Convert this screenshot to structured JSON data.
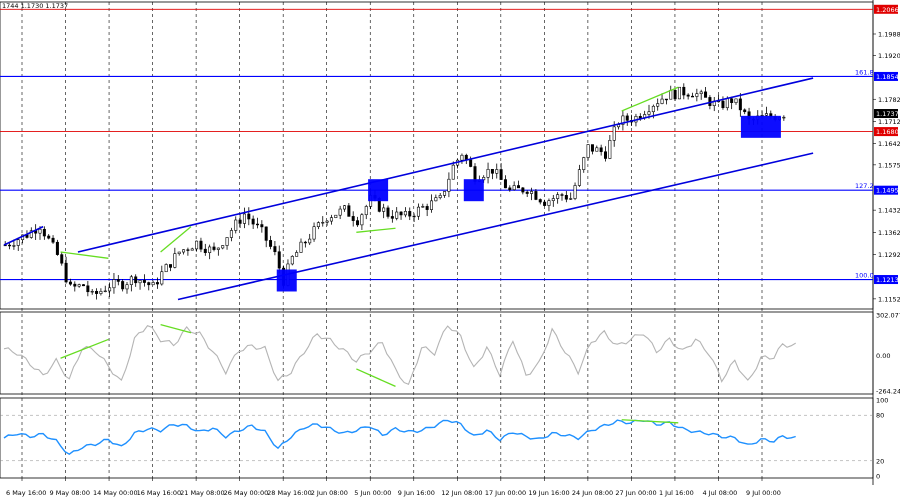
{
  "header_text": "1744 1.1730 1.1737",
  "colors": {
    "candle": "#000000",
    "channel": "#0000dd",
    "fib_line": "#0000ff",
    "red_line": "#e00000",
    "marker": "#0000ff",
    "divergence": "#66dd22",
    "cci": "#b4b4b4",
    "rsi": "#1e90ff",
    "grid": "#000000"
  },
  "chart_data": [
    {
      "type": "candlestick",
      "ylim": [
        1.112,
        1.2089
      ],
      "price_ticks": [
        "1.1988",
        "1.1920",
        "1.1782",
        "1.1712",
        "1.1642",
        "1.1575",
        "1.1432",
        "1.1362",
        "1.1292",
        "1.1152"
      ],
      "x_tick_labels": [
        "6 May 16:00",
        "9 May 08:00",
        "14 May 00:00",
        "16 May 16:00",
        "21 May 08:00",
        "26 May 00:00",
        "28 May 16:00",
        "2 Jun 08:00",
        "5 Jun 00:00",
        "9 Jun 16:00",
        "12 Jun 08:00",
        "17 Jun 00:00",
        "19 Jun 16:00",
        "24 Jun 08:00",
        "27 Jun 00:00",
        "1 Jul 16:00",
        "4 Jul 08:00",
        "9 Jul 00:00"
      ],
      "bar_count": 180,
      "close_path": [
        [
          0,
          1.1322
        ],
        [
          5,
          1.1355
        ],
        [
          8,
          1.1385
        ],
        [
          12,
          1.129
        ],
        [
          15,
          1.1185
        ],
        [
          18,
          1.1195
        ],
        [
          20,
          1.116
        ],
        [
          24,
          1.1195
        ],
        [
          27,
          1.12
        ],
        [
          30,
          1.122
        ],
        [
          34,
          1.119
        ],
        [
          36,
          1.1232
        ],
        [
          40,
          1.13
        ],
        [
          44,
          1.133
        ],
        [
          48,
          1.13
        ],
        [
          52,
          1.137
        ],
        [
          55,
          1.142
        ],
        [
          59,
          1.1362
        ],
        [
          62,
          1.1292
        ],
        [
          64,
          1.121
        ],
        [
          66,
          1.128
        ],
        [
          70,
          1.135
        ],
        [
          74,
          1.1412
        ],
        [
          78,
          1.1432
        ],
        [
          81,
          1.1402
        ],
        [
          84,
          1.1465
        ],
        [
          88,
          1.142
        ],
        [
          92,
          1.1412
        ],
        [
          96,
          1.144
        ],
        [
          100,
          1.1465
        ],
        [
          103,
          1.157
        ],
        [
          105,
          1.1612
        ],
        [
          108,
          1.154
        ],
        [
          112,
          1.156
        ],
        [
          116,
          1.1492
        ],
        [
          120,
          1.15
        ],
        [
          124,
          1.146
        ],
        [
          128,
          1.148
        ],
        [
          130,
          1.147
        ],
        [
          134,
          1.163
        ],
        [
          138,
          1.1612
        ],
        [
          141,
          1.1712
        ],
        [
          145,
          1.1725
        ],
        [
          148,
          1.176
        ],
        [
          152,
          1.1795
        ],
        [
          156,
          1.1805
        ],
        [
          158,
          1.1805
        ],
        [
          161,
          1.1782
        ],
        [
          164,
          1.176
        ],
        [
          167,
          1.178
        ],
        [
          169,
          1.1755
        ],
        [
          171,
          1.1712
        ],
        [
          174,
          1.1725
        ],
        [
          177,
          1.173
        ],
        [
          179,
          1.1737
        ]
      ],
      "horizontal_levels": [
        {
          "label": "1.2066",
          "value": 1.2066,
          "kind": "red"
        },
        {
          "label": "1.1854",
          "value": 1.1854,
          "kind": "blue",
          "fib_label": "161.8"
        },
        {
          "label": "1.1680",
          "value": 1.168,
          "kind": "red"
        },
        {
          "label": "1.1495",
          "value": 1.1495,
          "kind": "blue",
          "fib_label": "127.2"
        },
        {
          "label": "1.1213",
          "value": 1.1213,
          "kind": "blue",
          "fib_label": "100.0"
        }
      ],
      "current_price": "1.1737",
      "channel_lines": [
        {
          "from": [
            17,
            1.13
          ],
          "to": [
            186,
            1.1849
          ]
        },
        {
          "from": [
            40,
            1.115
          ],
          "to": [
            186,
            1.1612
          ]
        },
        {
          "from": [
            0,
            1.1322
          ],
          "to": [
            9,
            1.138
          ]
        }
      ],
      "markers": [
        {
          "bar": 65,
          "value": 1.121
        },
        {
          "bar": 86,
          "value": 1.1495
        },
        {
          "bar": 108,
          "value": 1.1495
        },
        {
          "bar": 174,
          "value": 1.1695
        }
      ],
      "divergence_lines": [
        {
          "from": [
            13,
            1.13
          ],
          "to": [
            24,
            1.128
          ]
        },
        {
          "from": [
            36,
            1.13
          ],
          "to": [
            43,
            1.138
          ]
        },
        {
          "from": [
            81,
            1.1362
          ],
          "to": [
            90,
            1.1375
          ]
        },
        {
          "from": [
            142,
            1.1745
          ],
          "to": [
            155,
            1.182
          ]
        }
      ]
    },
    {
      "type": "line",
      "name": "",
      "ylim": [
        -264.246,
        302.077
      ],
      "ticks": [
        "302.077",
        "0.00",
        "-264.246"
      ],
      "values_by_bar": [
        [
          0,
          50
        ],
        [
          3,
          20
        ],
        [
          6,
          -60
        ],
        [
          9,
          -150
        ],
        [
          12,
          -40
        ],
        [
          15,
          -180
        ],
        [
          18,
          60
        ],
        [
          21,
          40
        ],
        [
          24,
          -80
        ],
        [
          27,
          -200
        ],
        [
          30,
          120
        ],
        [
          33,
          230
        ],
        [
          36,
          120
        ],
        [
          39,
          80
        ],
        [
          42,
          200
        ],
        [
          45,
          160
        ],
        [
          48,
          30
        ],
        [
          51,
          -120
        ],
        [
          54,
          40
        ],
        [
          57,
          70
        ],
        [
          60,
          50
        ],
        [
          63,
          -190
        ],
        [
          66,
          -120
        ],
        [
          69,
          30
        ],
        [
          72,
          160
        ],
        [
          75,
          110
        ],
        [
          78,
          40
        ],
        [
          81,
          -40
        ],
        [
          84,
          30
        ],
        [
          87,
          100
        ],
        [
          90,
          -110
        ],
        [
          93,
          -230
        ],
        [
          96,
          60
        ],
        [
          99,
          20
        ],
        [
          102,
          230
        ],
        [
          105,
          140
        ],
        [
          108,
          -100
        ],
        [
          111,
          60
        ],
        [
          114,
          -140
        ],
        [
          117,
          120
        ],
        [
          120,
          -150
        ],
        [
          123,
          -60
        ],
        [
          126,
          190
        ],
        [
          129,
          30
        ],
        [
          132,
          -120
        ],
        [
          135,
          100
        ],
        [
          138,
          170
        ],
        [
          141,
          70
        ],
        [
          144,
          120
        ],
        [
          147,
          170
        ],
        [
          150,
          30
        ],
        [
          153,
          120
        ],
        [
          156,
          30
        ],
        [
          159,
          120
        ],
        [
          162,
          20
        ],
        [
          165,
          -180
        ],
        [
          168,
          -40
        ],
        [
          171,
          -200
        ],
        [
          174,
          -20
        ],
        [
          177,
          -10
        ],
        [
          179,
          80
        ],
        [
          182,
          75
        ]
      ],
      "divergence_lines": [
        {
          "from": [
            13,
            -20
          ],
          "to": [
            24,
            120
          ]
        },
        {
          "from": [
            36,
            230
          ],
          "to": [
            43,
            170
          ]
        },
        {
          "from": [
            81,
            -100
          ],
          "to": [
            90,
            -230
          ]
        }
      ]
    },
    {
      "type": "line",
      "name": "",
      "ylim": [
        0,
        100
      ],
      "ticks": [
        "100",
        "80",
        "20",
        "0"
      ],
      "values_by_bar": [
        [
          0,
          50
        ],
        [
          3,
          56
        ],
        [
          6,
          52
        ],
        [
          9,
          55
        ],
        [
          12,
          46
        ],
        [
          15,
          28
        ],
        [
          18,
          38
        ],
        [
          21,
          42
        ],
        [
          24,
          48
        ],
        [
          27,
          38
        ],
        [
          30,
          56
        ],
        [
          33,
          62
        ],
        [
          36,
          60
        ],
        [
          39,
          68
        ],
        [
          42,
          66
        ],
        [
          45,
          58
        ],
        [
          48,
          63
        ],
        [
          51,
          52
        ],
        [
          54,
          60
        ],
        [
          57,
          66
        ],
        [
          60,
          58
        ],
        [
          63,
          36
        ],
        [
          66,
          52
        ],
        [
          69,
          64
        ],
        [
          72,
          68
        ],
        [
          75,
          62
        ],
        [
          78,
          56
        ],
        [
          81,
          60
        ],
        [
          84,
          66
        ],
        [
          87,
          54
        ],
        [
          90,
          62
        ],
        [
          93,
          58
        ],
        [
          96,
          60
        ],
        [
          99,
          66
        ],
        [
          102,
          74
        ],
        [
          105,
          68
        ],
        [
          108,
          52
        ],
        [
          111,
          60
        ],
        [
          114,
          48
        ],
        [
          117,
          58
        ],
        [
          120,
          52
        ],
        [
          123,
          48
        ],
        [
          126,
          56
        ],
        [
          129,
          54
        ],
        [
          132,
          50
        ],
        [
          135,
          60
        ],
        [
          138,
          66
        ],
        [
          141,
          72
        ],
        [
          144,
          70
        ],
        [
          147,
          74
        ],
        [
          150,
          68
        ],
        [
          153,
          70
        ],
        [
          156,
          62
        ],
        [
          159,
          58
        ],
        [
          162,
          56
        ],
        [
          165,
          52
        ],
        [
          168,
          50
        ],
        [
          171,
          40
        ],
        [
          174,
          48
        ],
        [
          177,
          46
        ],
        [
          179,
          52
        ],
        [
          182,
          50
        ]
      ],
      "divergence_lines": [
        {
          "from": [
            142,
            74
          ],
          "to": [
            155,
            70
          ]
        }
      ]
    }
  ]
}
